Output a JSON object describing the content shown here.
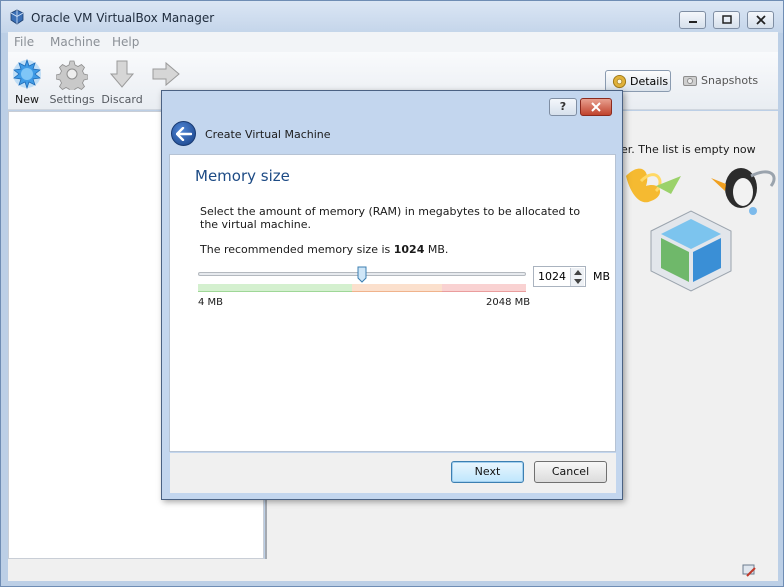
{
  "window": {
    "title": "Oracle VM VirtualBox Manager"
  },
  "menu": {
    "items": [
      "File",
      "Machine",
      "Help"
    ]
  },
  "toolbar": {
    "new": "New",
    "settings": "Settings",
    "discard": "Discard",
    "start": "St",
    "details": "Details",
    "snapshots": "Snapshots"
  },
  "right_pane": {
    "empty_text": "er. The list is empty now"
  },
  "dialog": {
    "title": "Create Virtual Machine",
    "help_label": "?",
    "heading": "Memory size",
    "description": "Select the amount of memory (RAM) in megabytes to be allocated to the virtual machine.",
    "recommended_prefix": "The recommended memory size is",
    "recommended_value": "1024",
    "recommended_suffix": "MB.",
    "slider": {
      "min_label": "4 MB",
      "max_label": "2048 MB",
      "min": 4,
      "max": 2048,
      "value": 1024
    },
    "spin_value": "1024",
    "unit": "MB",
    "next_label": "Next",
    "cancel_label": "Cancel"
  },
  "colors": {
    "heading": "#1d4b85",
    "frame": "#bccfe6"
  }
}
